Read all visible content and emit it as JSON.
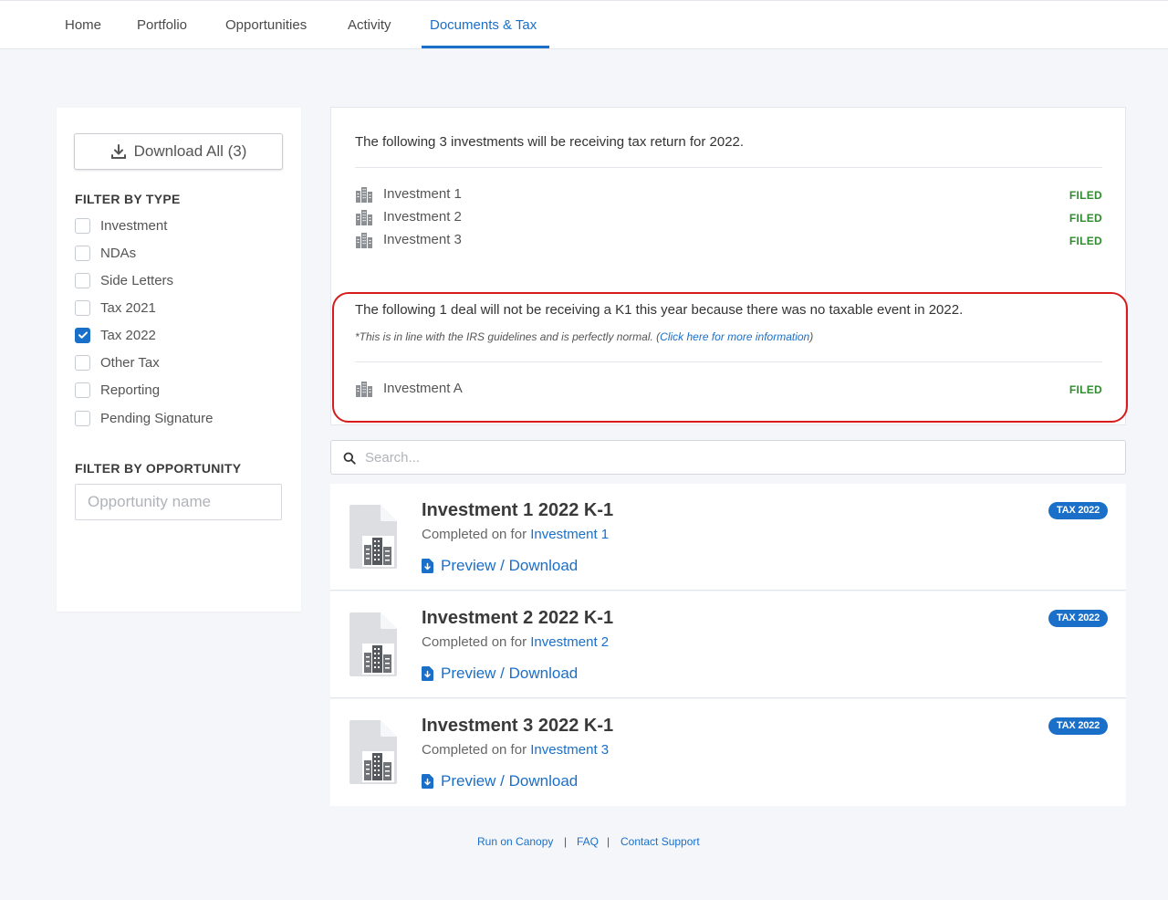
{
  "nav": {
    "tabs": [
      {
        "label": "Home"
      },
      {
        "label": "Portfolio"
      },
      {
        "label": "Opportunities"
      },
      {
        "label": "Activity"
      },
      {
        "label": "Documents & Tax",
        "active": true
      }
    ]
  },
  "sidebar": {
    "download_all": "Download All (3)",
    "filter_type_heading": "FILTER BY TYPE",
    "types": [
      {
        "label": "Investment",
        "checked": false
      },
      {
        "label": "NDAs",
        "checked": false
      },
      {
        "label": "Side Letters",
        "checked": false
      },
      {
        "label": "Tax 2021",
        "checked": false
      },
      {
        "label": "Tax 2022",
        "checked": true
      },
      {
        "label": "Other Tax",
        "checked": false
      },
      {
        "label": "Reporting",
        "checked": false
      },
      {
        "label": "Pending Signature",
        "checked": false
      }
    ],
    "filter_opportunity_heading": "FILTER BY OPPORTUNITY",
    "opportunity_placeholder": "Opportunity name"
  },
  "tax_panel": {
    "receiving_intro": "The following 3 investments will be receiving tax return for 2022.",
    "receiving": [
      {
        "name": "Investment 1",
        "status": "FILED"
      },
      {
        "name": "Investment 2",
        "status": "FILED"
      },
      {
        "name": "Investment 3",
        "status": "FILED"
      }
    ],
    "not_receiving_intro": "The following 1 deal will not be receiving a K1 this year because there was no taxable event in 2022.",
    "note_prefix": "*This is in line with the IRS guidelines and is perfectly normal. (",
    "note_link": "Click here for more information",
    "note_suffix": ")",
    "not_receiving": [
      {
        "name": "Investment A",
        "status": "FILED"
      }
    ]
  },
  "search": {
    "placeholder": "Search..."
  },
  "documents": [
    {
      "title": "Investment 1 2022 K-1",
      "sub_prefix": "Completed on for",
      "investment": "Investment 1",
      "action": "Preview / Download",
      "badge": "TAX 2022"
    },
    {
      "title": "Investment 2 2022 K-1",
      "sub_prefix": "Completed on for",
      "investment": "Investment 2",
      "action": "Preview / Download",
      "badge": "TAX 2022"
    },
    {
      "title": "Investment 3 2022 K-1",
      "sub_prefix": "Completed on for",
      "investment": "Investment 3",
      "action": "Preview / Download",
      "badge": "TAX 2022"
    }
  ],
  "footer": {
    "run_on": "Run on Canopy",
    "sep": "|",
    "faq": "FAQ",
    "contact": "Contact Support"
  },
  "colors": {
    "accent": "#1a6fc9",
    "filed": "#2e8b2e",
    "highlight": "#d81c1c"
  }
}
